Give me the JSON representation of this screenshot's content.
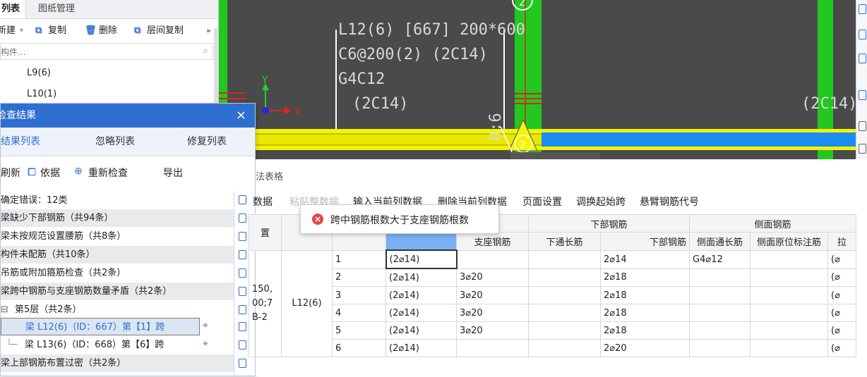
{
  "cad": {
    "beam_label_lines": [
      "L12(6) [667] 200*600",
      "C6@200(2) (2C14)",
      "G4C12",
      "(2C14)"
    ],
    "axis_y": "Y",
    "axis_x": "X",
    "axis_num_top": "2",
    "axis_num_bottom": "2",
    "rotated_label": "0:6",
    "right_label": "(2C14)"
  },
  "component_panel": {
    "tabs": [
      "列表",
      "图纸管理"
    ],
    "toolbar": {
      "new": "新建",
      "copy": "复制",
      "delete": "删除",
      "floor_copy": "层间复制",
      "more": "»"
    },
    "search_placeholder": "构件...",
    "items": [
      "L9(6)",
      "L10(1)"
    ]
  },
  "check_dialog": {
    "title": "检查结果",
    "close": "×",
    "tabs": [
      "结果列表",
      "忽略列表",
      "修复列表"
    ],
    "tools": {
      "refresh": "刷新",
      "basis": "依据",
      "recheck": "重新检查",
      "export": "导出"
    },
    "summary": "确定错误：12类",
    "rows": [
      "梁缺少下部钢筋（共94条）",
      "梁未按规范设置腰筋（共8条）",
      "构件未配筋（共10条）",
      "吊筋或附加箍筋检查（共2条）",
      "梁跨中钢筋与支座钢筋数量矛盾（共2条）",
      "第5层（共2条）",
      "梁 L12(6)（ID：667）第【1】跨",
      "梁 L13(6)（ID：668）第【6】跨",
      "梁上部钢筋布置过密（共2条）"
    ]
  },
  "table_section": {
    "title": "法表格",
    "menu": [
      "数据",
      "粘贴整数据",
      "输入当前列数据",
      "删除当前列数据",
      "页面设置",
      "调换起始跨",
      "悬臂钢筋代号"
    ],
    "headers_top": [
      "置",
      "下部钢筋",
      "侧面钢筋"
    ],
    "headers_sub": [
      "支座钢筋",
      "下通长筋",
      "下部钢筋",
      "侧面通长筋",
      "侧面原位标注筋",
      "拉"
    ],
    "merged_left": "150,\n00;7\nB-2",
    "beam_name": "L12(6)",
    "rows": [
      {
        "span": "1",
        "mid": "(2⌀14)",
        "support": "",
        "bottom_through": "",
        "bottom": "2⌀14",
        "side_through": "G4⌀12",
        "side_local": "",
        "tie": "(⌀"
      },
      {
        "span": "2",
        "mid": "(2⌀14)",
        "support": "3⌀20",
        "bottom_through": "",
        "bottom": "2⌀18",
        "side_through": "",
        "side_local": "",
        "tie": "(⌀"
      },
      {
        "span": "3",
        "mid": "(2⌀14)",
        "support": "3⌀20",
        "bottom_through": "",
        "bottom": "2⌀18",
        "side_through": "",
        "side_local": "",
        "tie": "(⌀"
      },
      {
        "span": "4",
        "mid": "(2⌀14)",
        "support": "3⌀20",
        "bottom_through": "",
        "bottom": "2⌀18",
        "side_through": "",
        "side_local": "",
        "tie": "(⌀"
      },
      {
        "span": "5",
        "mid": "(2⌀14)",
        "support": "3⌀20",
        "bottom_through": "",
        "bottom": "2⌀18",
        "side_through": "",
        "side_local": "",
        "tie": "(⌀"
      },
      {
        "span": "6",
        "mid": "(2⌀14)",
        "support": "",
        "bottom_through": "",
        "bottom": "2⌀20",
        "side_through": "",
        "side_local": "",
        "tie": "(⌀"
      }
    ]
  },
  "tooltip": {
    "message": "跨中钢筋根数大于支座钢筋根数"
  },
  "colors": {
    "accent": "#2f6fd1",
    "cad_bg": "#4a4a4a",
    "beam_yellow": "#f5f500",
    "column_green": "#22c81f",
    "error_red": "#e84545"
  }
}
